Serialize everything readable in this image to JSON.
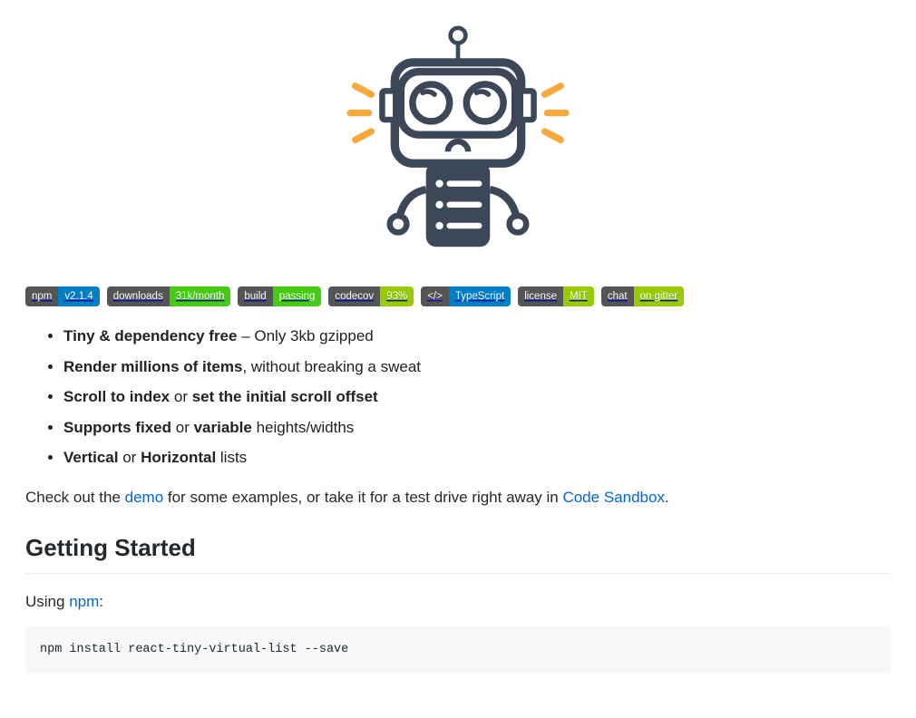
{
  "badges": {
    "npm": {
      "label": "npm",
      "value": "v2.1.4"
    },
    "downloads": {
      "label": "downloads",
      "value": "31k/month"
    },
    "build": {
      "label": "build",
      "value": "passing"
    },
    "codecov": {
      "label": "codecov",
      "value": "93%"
    },
    "typescript": {
      "label": "</>",
      "value": "TypeScript"
    },
    "license": {
      "label": "license",
      "value": "MIT"
    },
    "chat": {
      "label": "chat",
      "value": "on gitter"
    }
  },
  "features": {
    "item1_bold": "Tiny & dependency free",
    "item1_rest": " – Only 3kb gzipped",
    "item2_bold": "Render millions of items",
    "item2_rest": ", without breaking a sweat",
    "item3_bold1": "Scroll to index",
    "item3_mid": " or ",
    "item3_bold2": "set the initial scroll offset",
    "item4_bold1": "Supports fixed",
    "item4_mid": " or ",
    "item4_bold2": "variable",
    "item4_rest": " heights/widths",
    "item5_bold1": "Vertical",
    "item5_mid": " or ",
    "item5_bold2": "Horizontal",
    "item5_rest": " lists"
  },
  "intro": {
    "prefix": "Check out the ",
    "demo_link": "demo",
    "mid": " for some examples, or take it for a test drive right away in ",
    "sandbox_link": "Code Sandbox",
    "suffix": "."
  },
  "section_heading": "Getting Started",
  "using": {
    "prefix": "Using ",
    "link": "npm",
    "suffix": ":"
  },
  "code_block": "npm install react-tiny-virtual-list --save"
}
